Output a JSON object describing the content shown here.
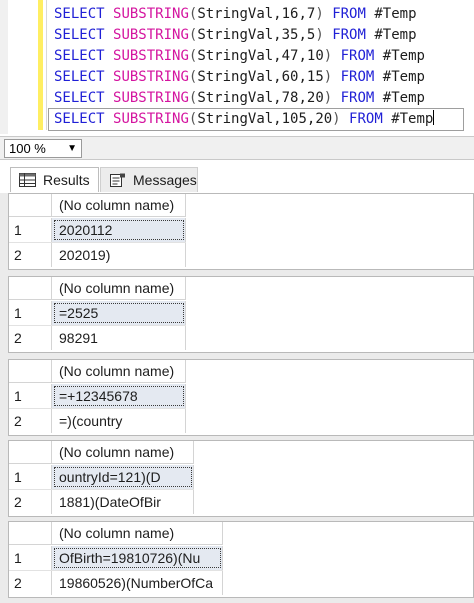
{
  "editor": {
    "lines": [
      {
        "kw_select": "SELECT",
        "fn": "SUBSTRING",
        "open": "(",
        "args": "StringVal,16,7",
        "close": ")",
        "kw_from": "FROM",
        "table": "#Temp"
      },
      {
        "kw_select": "SELECT",
        "fn": "SUBSTRING",
        "open": "(",
        "args": "StringVal,35,5",
        "close": ")",
        "kw_from": "FROM",
        "table": "#Temp"
      },
      {
        "kw_select": "SELECT",
        "fn": "SUBSTRING",
        "open": "(",
        "args": "StringVal,47,10",
        "close": ")",
        "kw_from": "FROM",
        "table": "#Temp"
      },
      {
        "kw_select": "SELECT",
        "fn": "SUBSTRING",
        "open": "(",
        "args": "StringVal,60,15",
        "close": ")",
        "kw_from": "FROM",
        "table": "#Temp"
      },
      {
        "kw_select": "SELECT",
        "fn": "SUBSTRING",
        "open": "(",
        "args": "StringVal,78,20",
        "close": ")",
        "kw_from": "FROM",
        "table": "#Temp"
      },
      {
        "kw_select": "SELECT",
        "fn": "SUBSTRING",
        "open": "(",
        "args": "StringVal,105,20",
        "close": ")",
        "kw_from": "FROM",
        "table": "#Temp"
      }
    ],
    "colors": {
      "keyword": "#1f1fd6",
      "function": "#d4149f",
      "change_bar": "#ffee62"
    }
  },
  "zoom": {
    "value": "100 %",
    "icon": "chevron-down-icon"
  },
  "tabs": {
    "results": {
      "label": "Results",
      "icon": "grid-icon"
    },
    "messages": {
      "label": "Messages",
      "icon": "messages-icon"
    }
  },
  "result_sets": [
    {
      "header": "(No column name)",
      "rows": [
        {
          "num": "1",
          "value": "2020112"
        },
        {
          "num": "2",
          "value": "202019)"
        }
      ]
    },
    {
      "header": "(No column name)",
      "rows": [
        {
          "num": "1",
          "value": "=2525"
        },
        {
          "num": "2",
          "value": "98291"
        }
      ]
    },
    {
      "header": "(No column name)",
      "rows": [
        {
          "num": "1",
          "value": "=+12345678"
        },
        {
          "num": "2",
          "value": "=)(country"
        }
      ]
    },
    {
      "header": "(No column name)",
      "rows": [
        {
          "num": "1",
          "value": "ountryId=121)(D"
        },
        {
          "num": "2",
          "value": "1881)(DateOfBir"
        }
      ]
    },
    {
      "header": "(No column name)",
      "rows": [
        {
          "num": "1",
          "value": "OfBirth=19810726)(Nu"
        },
        {
          "num": "2",
          "value": "19860526)(NumberOfCa"
        }
      ]
    }
  ]
}
